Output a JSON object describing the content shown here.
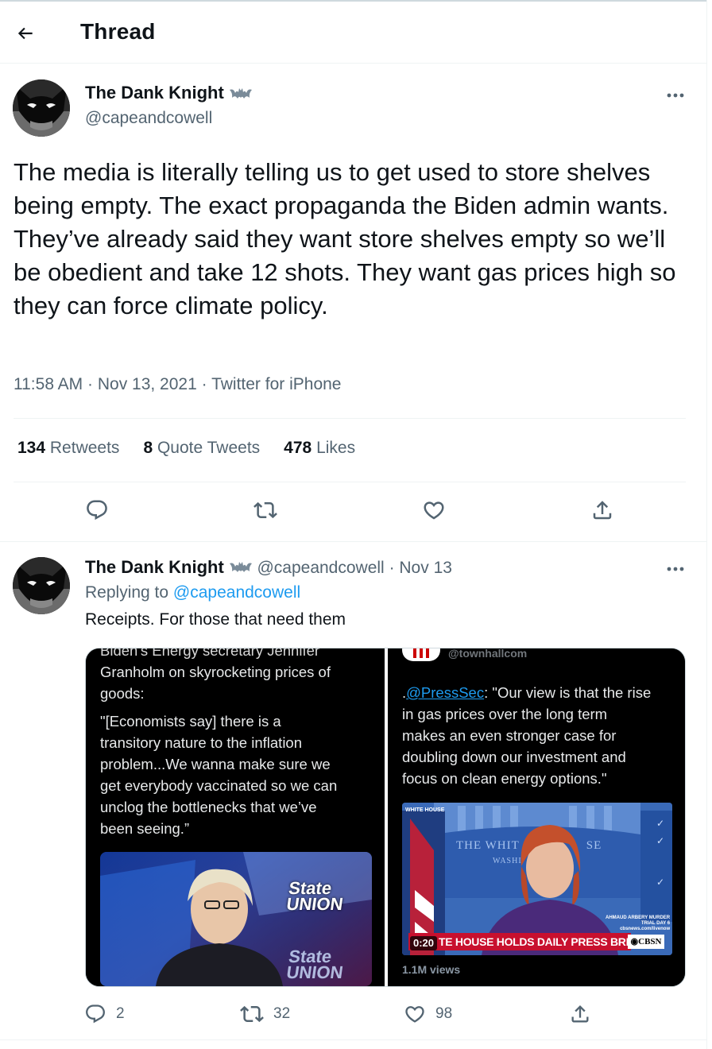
{
  "header": {
    "title": "Thread",
    "back_icon": "arrow-left-icon"
  },
  "main_tweet": {
    "author_name": "The Dank Knight",
    "author_handle": "@capeandcowell",
    "text": "The media is literally telling us to get used to store shelves being empty. The exact propaganda the Biden admin wants. They’ve already said they want store shelves empty so we’ll be obedient and take 12 shots. They want gas prices high so they can force climate policy.",
    "time": "11:58 AM",
    "date": "Nov 13, 2021",
    "client": "Twitter for iPhone",
    "retweets_count": "134",
    "retweets_label": "Retweets",
    "quotes_count": "8",
    "quotes_label": "Quote Tweets",
    "likes_count": "478",
    "likes_label": "Likes"
  },
  "reply_tweet": {
    "author_name": "The Dank Knight",
    "author_handle": "@capeandcowell",
    "date": "Nov 13",
    "replying_prefix": "Replying to",
    "replying_to": "@capeandcowell",
    "text": "Receipts. For those that need them",
    "media_left": {
      "cut_line": "Biden's Energy secretary Jennifer",
      "line1": "Granholm on skyrocketing prices of",
      "line2": "goods:",
      "quote1": "\"[Economists say] there is a",
      "quote2": "transitory nature to the inflation",
      "quote3": "problem...We wanna make sure we",
      "quote4": "get everybody vaccinated so we can",
      "quote5": "unclog the bottlenecks that we’ve",
      "quote6": "been seeing.”",
      "logo_line1": "State",
      "logo_line2": "UNION",
      "logo2_line1": "State",
      "logo2_line2": "UNION"
    },
    "media_right": {
      "cut_handle": "@townhallcom",
      "mention": "@PressSec",
      "line1_rest": ": \"Our view is that the rise",
      "line2": "in gas prices over the long term",
      "line3": "makes an even stronger case for",
      "line4": "doubling down our investment and",
      "line5": "focus on clean energy options.\"",
      "podium_text": "THE WHIT",
      "podium_text2": "SE",
      "podium_small": "WASHI",
      "wh_tag": "WHITE HOUSE",
      "chyron": "TE HOUSE HOLDS DAILY PRESS BRIEFING",
      "network": "CBSN",
      "timestamp": "0:20",
      "side_text1": "AHMAUD ARBERY MURDER",
      "side_text2": "TRIAL DAY 6",
      "side_text3": "cbsnews.com/livenow",
      "views": "1.1M views"
    },
    "replies_count": "2",
    "retweets_count": "32",
    "likes_count": "98"
  },
  "colors": {
    "accent": "#1d9bf0",
    "secondary_text": "#536471",
    "divider": "#eff3f4"
  }
}
